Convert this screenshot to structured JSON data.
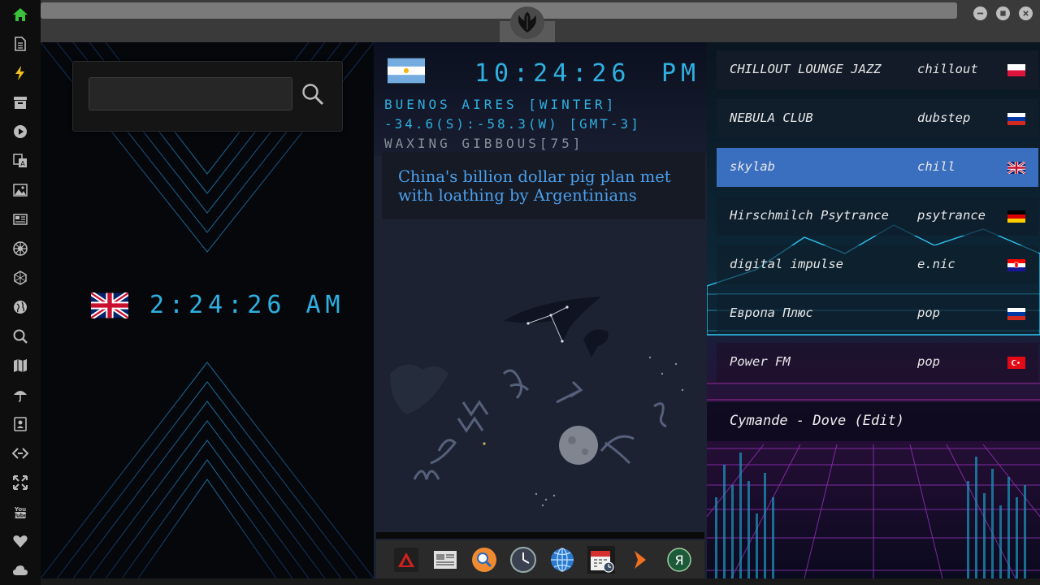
{
  "sidebar": {
    "items": [
      {
        "name": "home-icon",
        "color": "#3ac23a"
      },
      {
        "name": "document-icon"
      },
      {
        "name": "lightning-icon",
        "color": "#f0c020"
      },
      {
        "name": "archive-icon"
      },
      {
        "name": "play-icon"
      },
      {
        "name": "translate-icon"
      },
      {
        "name": "image-icon"
      },
      {
        "name": "news-icon"
      },
      {
        "name": "empire-icon"
      },
      {
        "name": "hexagon-icon"
      },
      {
        "name": "globe-icon"
      },
      {
        "name": "search-icon"
      },
      {
        "name": "map-icon"
      },
      {
        "name": "umbrella-icon"
      },
      {
        "name": "contacts-icon"
      },
      {
        "name": "code-icon"
      },
      {
        "name": "expand-icon"
      },
      {
        "name": "youtube-icon",
        "label": "You Tube"
      },
      {
        "name": "heart-icon"
      },
      {
        "name": "cloud-icon"
      }
    ]
  },
  "window": {
    "logo": "rebel-alliance-icon",
    "buttons": [
      "minimize-icon",
      "maximize-icon",
      "close-icon"
    ]
  },
  "left_panel": {
    "search": {
      "value": "",
      "placeholder": ""
    },
    "clock": {
      "flag": "uk-flag",
      "time": "2:24:26",
      "ampm": "AM"
    }
  },
  "center_panel": {
    "clock": {
      "flag": "argentina-flag",
      "time": "10:24:26",
      "ampm": "PM"
    },
    "location": "BUENOS AIRES [WINTER]",
    "coords": "-34.6(S):-58.3(W) [GMT-3]",
    "moon": "WAXING GIBBOUS[75]",
    "headline": "China's billion dollar pig plan met with loathing by Argentinians",
    "dock": [
      "app-red-triangle-icon",
      "news-reader-icon",
      "search-app-icon",
      "clock-app-icon",
      "globe-app-icon",
      "calendar-app-icon",
      "media-play-icon",
      "yandex-icon"
    ]
  },
  "radio": {
    "stations": [
      {
        "name": "CHILLOUT LOUNGE JAZZ",
        "genre": "chillout",
        "flag": "poland-flag",
        "selected": false
      },
      {
        "name": "NEBULA CLUB",
        "genre": "dubstep",
        "flag": "russia-flag",
        "selected": false
      },
      {
        "name": "skylab",
        "genre": "chill",
        "flag": "uk-flag",
        "selected": true
      },
      {
        "name": "Hirschmilch Psytrance",
        "genre": "psytrance",
        "flag": "germany-flag",
        "selected": false
      },
      {
        "name": "digital impulse",
        "genre": "e.nic",
        "flag": "croatia-flag",
        "selected": false
      },
      {
        "name": "Европа Плюс",
        "genre": "pop",
        "flag": "russia-flag",
        "selected": false
      },
      {
        "name": "Power FM",
        "genre": "pop",
        "flag": "turkey-flag",
        "selected": false
      }
    ],
    "now_playing": "Cymande - Dove (Edit)",
    "accent": "#3a6fc0"
  }
}
